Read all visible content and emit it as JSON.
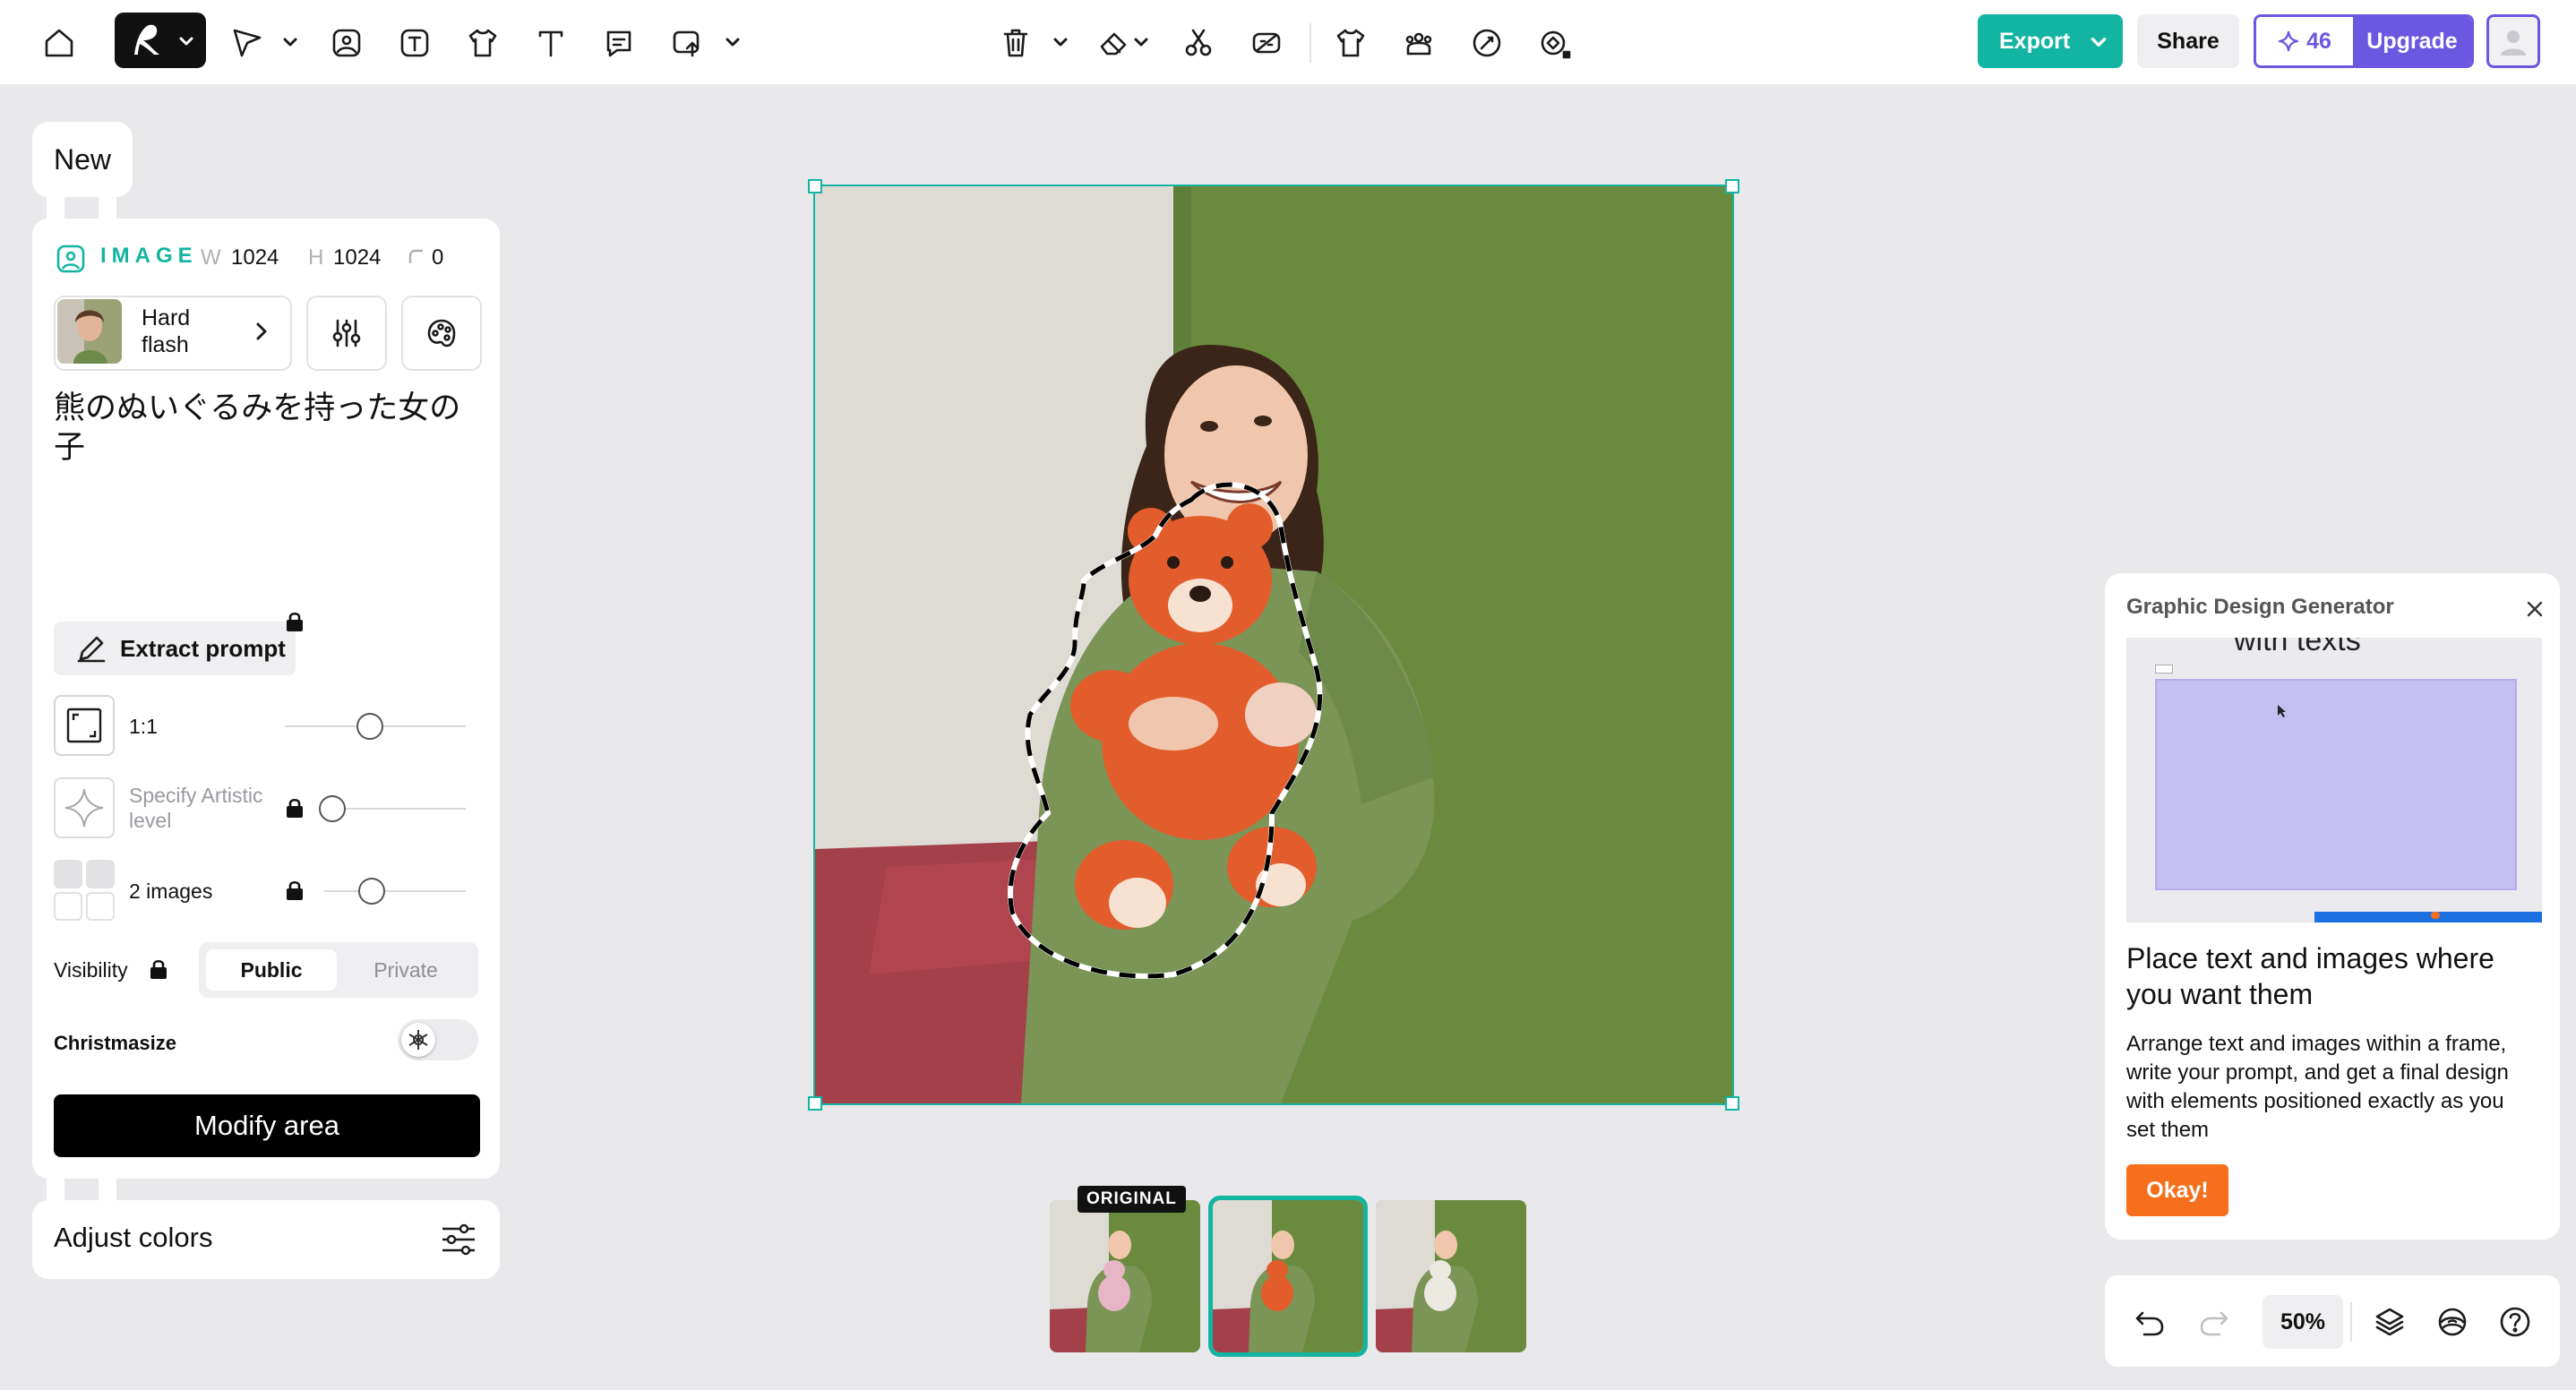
{
  "toolbar": {
    "tools": [
      "home",
      "logo-menu",
      "select",
      "image",
      "ai-image",
      "mockup",
      "text",
      "comment",
      "upload"
    ],
    "export_label": "Export",
    "share_label": "Share",
    "credits": "46",
    "upgrade_label": "Upgrade"
  },
  "panel": {
    "new_label": "New",
    "type_label": "IMAGE",
    "width_label": "W",
    "width_value": "1024",
    "height_label": "H",
    "height_value": "1024",
    "radius_value": "0",
    "style_name": "Hard flash",
    "prompt": "熊のぬいぐるみを持った女の子",
    "extract_label": "Extract prompt",
    "aspect_label": "1:1",
    "artistic_label": "Specify Artistic level",
    "images_label": "2 images",
    "visibility_label": "Visibility",
    "visibility_public": "Public",
    "visibility_private": "Private",
    "christmas_label": "Christmasize",
    "modify_label": "Modify area",
    "adjust_label": "Adjust colors"
  },
  "thumbnails": {
    "original_tag": "ORIGINAL",
    "selected_index": 1
  },
  "help_card": {
    "title": "Graphic Design Generator",
    "preview_text": "with texts",
    "heading": "Place text and images where you want them",
    "body": "Arrange text and images within a frame, write your prompt, and get a final design with elements positioned exactly as you set them",
    "button": "Okay!"
  },
  "bottom_bar": {
    "zoom": "50%"
  },
  "colors": {
    "accent": "#13b5a2",
    "brand_purple": "#6c58e0",
    "okay_orange": "#f56f1c"
  }
}
